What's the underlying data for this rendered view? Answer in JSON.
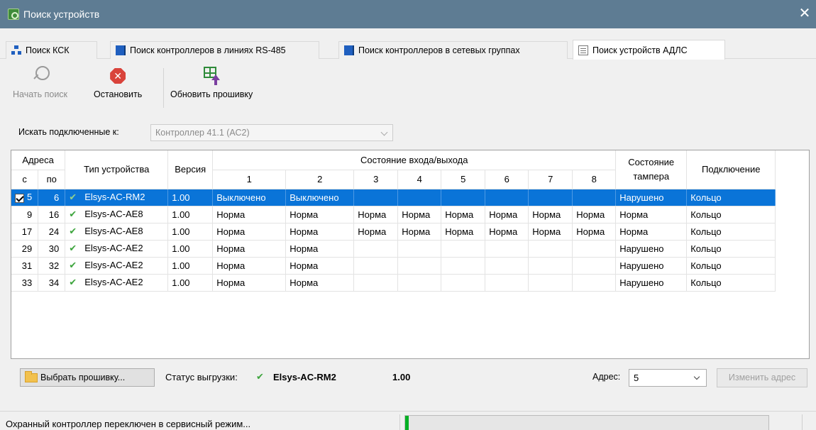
{
  "window": {
    "title": "Поиск устройств",
    "close_glyph": "✕"
  },
  "tabs": [
    {
      "label": "Поиск КСК",
      "icon": "network-icon"
    },
    {
      "label": "Поиск контроллеров в линиях RS-485",
      "icon": "book-icon"
    },
    {
      "label": "Поиск контроллеров в сетевых группах",
      "icon": "book-icon"
    },
    {
      "label": "Поиск устройств АДЛС",
      "icon": "device-icon",
      "active": true
    }
  ],
  "toolbar": {
    "start_label": "Начать поиск",
    "stop_label": "Остановить",
    "firmware_label": "Обновить прошивку"
  },
  "search": {
    "label": "Искать подключенные к:",
    "value": "Контроллер 41.1 (АС2)"
  },
  "table": {
    "headers": {
      "addresses": "Адреса",
      "from": "с",
      "to": "по",
      "type": "Тип устройства",
      "version": "Версия",
      "io_state": "Состояние входа/выхода",
      "io": [
        "1",
        "2",
        "3",
        "4",
        "5",
        "6",
        "7",
        "8"
      ],
      "tamper": "Состояние тампера",
      "connection": "Подключение"
    },
    "rows": [
      {
        "from": "5",
        "to": "6",
        "type": "Elsys-AC-RM2",
        "version": "1.00",
        "io": [
          "Выключено",
          "Выключено",
          "",
          "",
          "",
          "",
          "",
          ""
        ],
        "tamper": "Нарушено",
        "connection": "Кольцо",
        "selected": true,
        "checked": true
      },
      {
        "from": "9",
        "to": "16",
        "type": "Elsys-AC-AE8",
        "version": "1.00",
        "io": [
          "Норма",
          "Норма",
          "Норма",
          "Норма",
          "Норма",
          "Норма",
          "Норма",
          "Норма"
        ],
        "tamper": "Норма",
        "connection": "Кольцо"
      },
      {
        "from": "17",
        "to": "24",
        "type": "Elsys-AC-AE8",
        "version": "1.00",
        "io": [
          "Норма",
          "Норма",
          "Норма",
          "Норма",
          "Норма",
          "Норма",
          "Норма",
          "Норма"
        ],
        "tamper": "Норма",
        "connection": "Кольцо"
      },
      {
        "from": "29",
        "to": "30",
        "type": "Elsys-AC-AE2",
        "version": "1.00",
        "io": [
          "Норма",
          "Норма",
          "",
          "",
          "",
          "",
          "",
          ""
        ],
        "tamper": "Нарушено",
        "connection": "Кольцо"
      },
      {
        "from": "31",
        "to": "32",
        "type": "Elsys-AC-AE2",
        "version": "1.00",
        "io": [
          "Норма",
          "Норма",
          "",
          "",
          "",
          "",
          "",
          ""
        ],
        "tamper": "Нарушено",
        "connection": "Кольцо"
      },
      {
        "from": "33",
        "to": "34",
        "type": "Elsys-AC-AE2",
        "version": "1.00",
        "io": [
          "Норма",
          "Норма",
          "",
          "",
          "",
          "",
          "",
          ""
        ],
        "tamper": "Нарушено",
        "connection": "Кольцо"
      }
    ]
  },
  "firmware": {
    "select_label": "Выбрать прошивку...",
    "status_label": "Статус выгрузки:",
    "status_device": "Elsys-AC-RM2",
    "status_version": "1.00",
    "address_label": "Адрес:",
    "address_value": "5",
    "change_label": "Изменить адрес"
  },
  "statusbar": {
    "text": "Охранный контроллер переключен в сервисный режим...",
    "progress": 0.01
  },
  "colors": {
    "titlebar": "#5e7c93",
    "selection": "#0a74d8",
    "ok_check": "#3ea53e",
    "stop": "#d9433b"
  }
}
